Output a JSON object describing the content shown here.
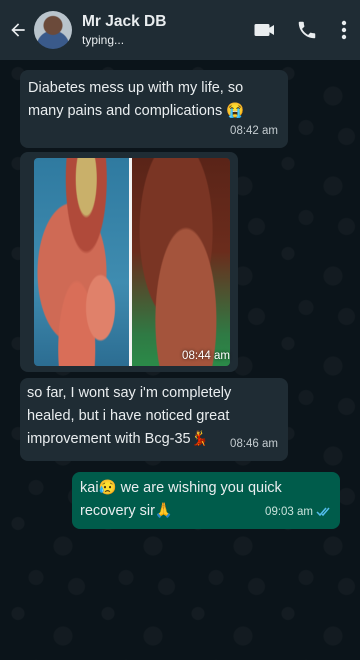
{
  "header": {
    "contact_name": "Mr Jack DB",
    "status": "typing..."
  },
  "icons": {
    "back": "arrow-left-icon",
    "video": "video-camera-icon",
    "call": "phone-icon",
    "menu": "vertical-dots-icon"
  },
  "colors": {
    "header_bg": "#1f2c34",
    "incoming_bubble": "#1f2c34",
    "outgoing_bubble": "#005c4b",
    "chat_bg": "#0b141a",
    "read_ticks": "#53bdeb"
  },
  "messages": [
    {
      "direction": "incoming",
      "text": "Diabetes mess up with my life, so many pains and complications 😭",
      "time": "08:42 am"
    },
    {
      "direction": "incoming",
      "type": "image",
      "time": "08:44 am"
    },
    {
      "direction": "incoming",
      "text": "so far, I wont say i'm completely healed, but i have noticed great improvement with Bcg-35💃",
      "time": "08:46 am"
    },
    {
      "direction": "outgoing",
      "text": "kai😥 we are wishing you quick recovery sir🙏",
      "time": "09:03 am",
      "status": "read"
    }
  ]
}
